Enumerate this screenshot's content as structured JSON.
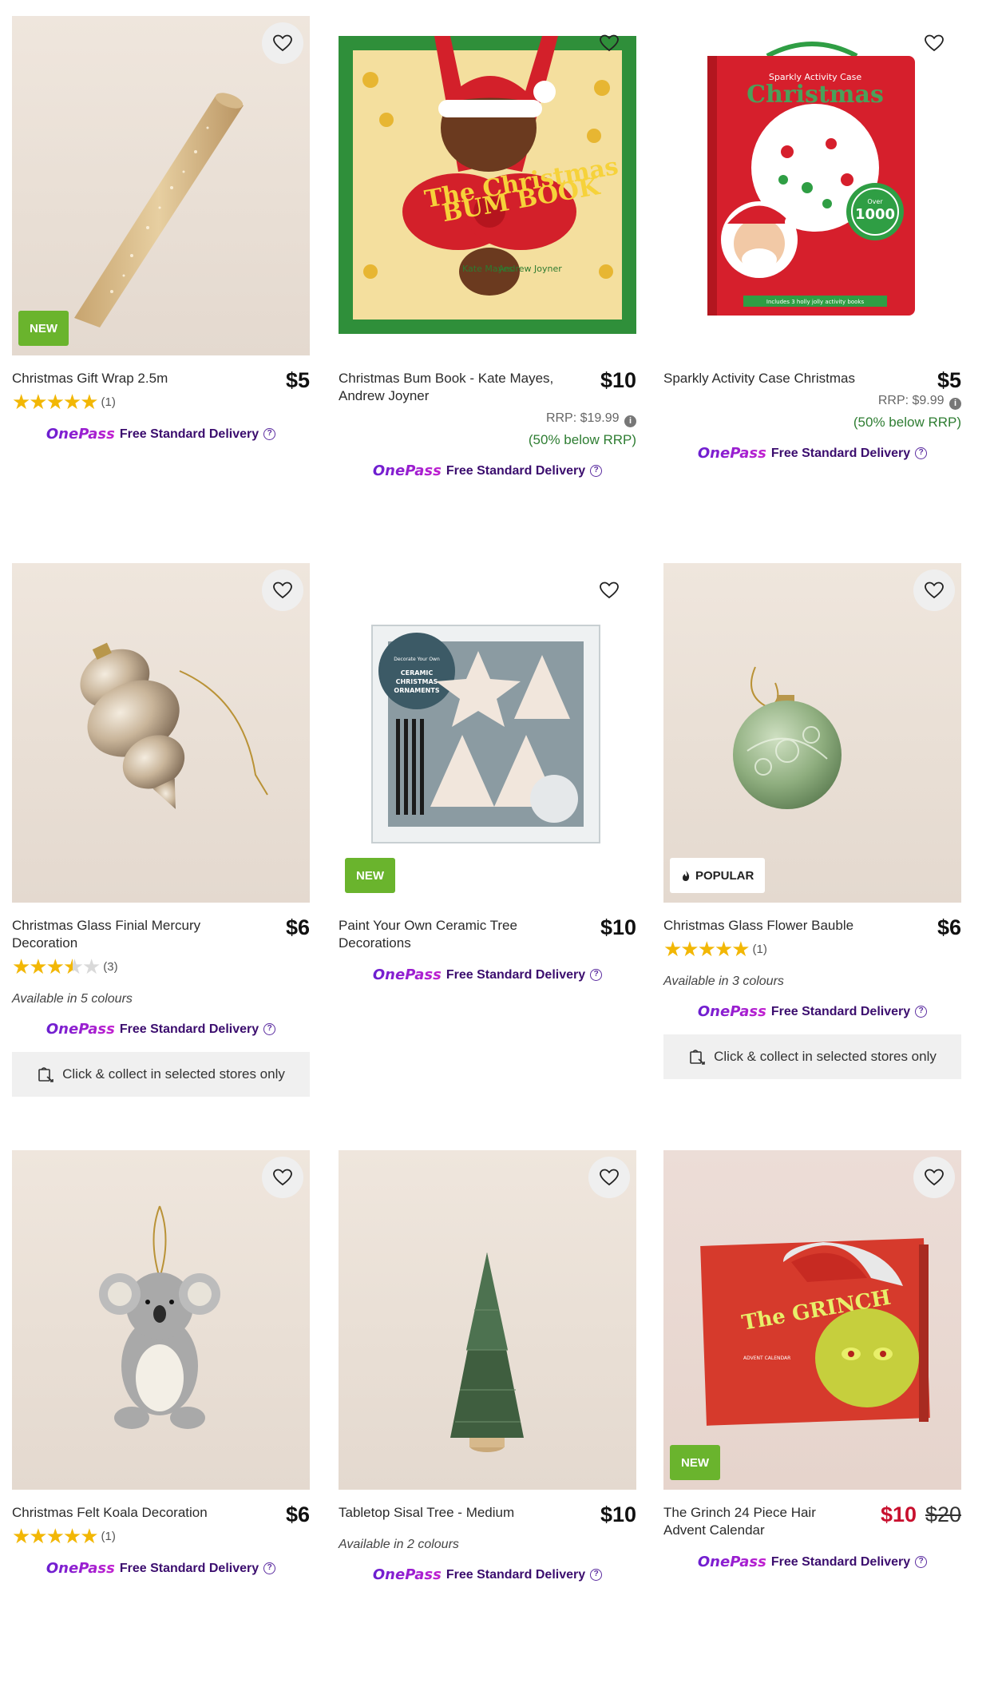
{
  "products": [
    {
      "title": "Christmas Gift Wrap 2.5m",
      "price": "$5",
      "rating_count": "(1)",
      "badge": "NEW",
      "delivery": "Free Standard Delivery"
    },
    {
      "title": "Christmas Bum Book - Kate Mayes, Andrew Joyner",
      "price": "$10",
      "rrp": "RRP: $19.99",
      "below_rrp": "(50% below RRP)",
      "delivery": "Free Standard Delivery",
      "cover": {
        "title_left": "The Christmas",
        "title_right": "BUM BOOK",
        "author": "Kate Mayes",
        "illustrator": "Andrew Joyner"
      }
    },
    {
      "title": "Sparkly Activity Case Christmas",
      "price": "$5",
      "rrp": "RRP: $9.99",
      "below_rrp": "(50% below RRP)",
      "delivery": "Free Standard Delivery",
      "box": {
        "small": "Sparkly Activity Case",
        "big": "Christmas",
        "stickers_top": "Over",
        "stickers_num": "1000",
        "footer": "Includes 3 holly jolly activity books"
      }
    },
    {
      "title": "Christmas Glass Finial Mercury Decoration",
      "price": "$6",
      "rating_count": "(3)",
      "colours": "Available in 5 colours",
      "delivery": "Free Standard Delivery",
      "collect": "Click & collect in selected stores only"
    },
    {
      "title": "Paint Your Own Ceramic Tree Decorations",
      "price": "$10",
      "badge": "NEW",
      "delivery": "Free Standard Delivery",
      "box": {
        "small": "Decorate Your Own",
        "big": "CERAMIC CHRISTMAS ORNAMENTS"
      }
    },
    {
      "title": "Christmas Glass Flower Bauble",
      "price": "$6",
      "rating_count": "(1)",
      "badge": "POPULAR",
      "colours": "Available in 3 colours",
      "delivery": "Free Standard Delivery",
      "collect": "Click & collect in selected stores only"
    },
    {
      "title": "Christmas Felt Koala Decoration",
      "price": "$6",
      "rating_count": "(1)",
      "delivery": "Free Standard Delivery"
    },
    {
      "title": "Tabletop Sisal Tree - Medium",
      "price": "$10",
      "colours": "Available in 2 colours",
      "delivery": "Free Standard Delivery"
    },
    {
      "title": "The Grinch 24 Piece Hair Advent Calendar",
      "price": "$10",
      "was_price": "$20",
      "badge": "NEW",
      "delivery": "Free Standard Delivery",
      "box": {
        "big": "The GRINCH",
        "small": "ADVENT CALENDAR"
      }
    }
  ],
  "brand": {
    "onepass": "OnePass"
  },
  "ratings": {
    "p0": 5,
    "p3": 3.5,
    "p5": 5,
    "p6": 5
  },
  "colors": {
    "badge_green": "#6ab42d",
    "sale_red": "#c8102e",
    "below_rrp_green": "#2e7d32",
    "onepass_purple": "#6a1fd0"
  }
}
